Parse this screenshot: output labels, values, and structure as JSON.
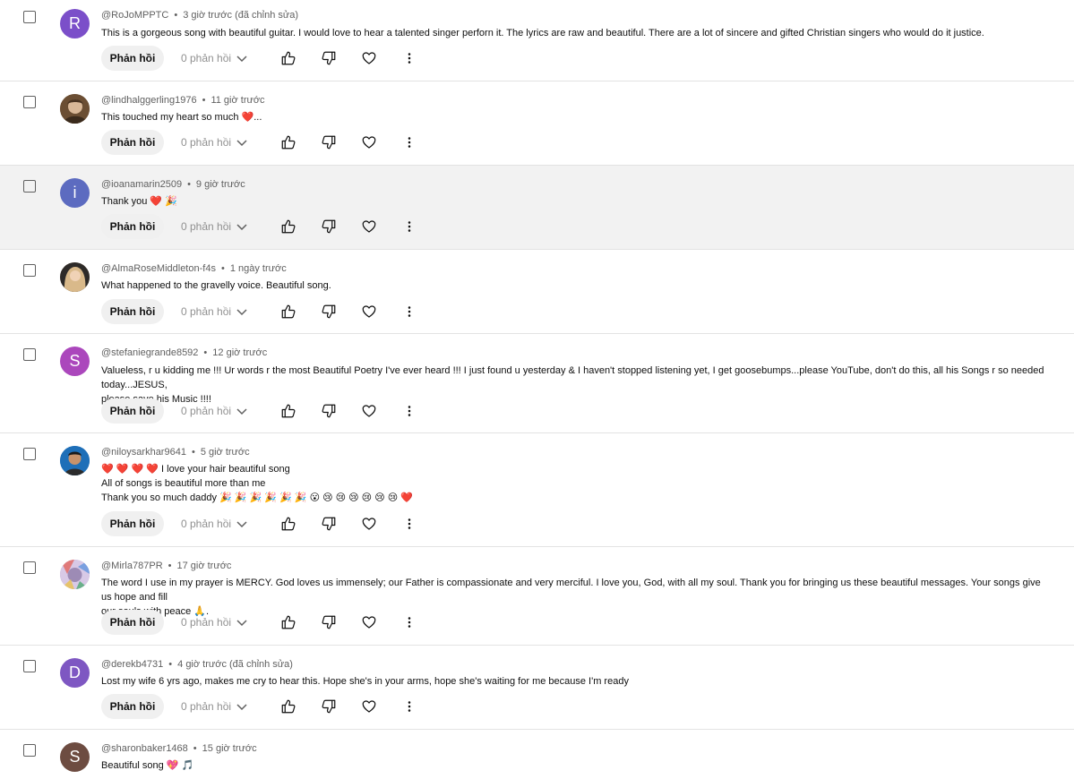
{
  "labels": {
    "reply_button": "Phản hồi",
    "reply_count": "0 phản hồi"
  },
  "comments": [
    {
      "handle": "@RoJoMPPTC",
      "time": "3 giờ trước (đã chỉnh sửa)",
      "text": [
        "This is a gorgeous song with beautiful guitar.   I would love to hear a talented singer perforn it.  The lyrics are raw and beautiful.  There are a lot of sincere and gifted Christian singers who would do it justice."
      ],
      "avatar_letter": "R",
      "avatar_color": "#7b4fc9"
    },
    {
      "handle": "@lindhalggerling1976",
      "time": "11 giờ trước",
      "text": [
        "This touched my heart so much ❤️..."
      ],
      "avatar_letter": "",
      "avatar_color": "#8a6a4a"
    },
    {
      "handle": "@ioanamarin2509",
      "time": "9 giờ trước",
      "text": [
        "Thank you ❤️ 🎉"
      ],
      "avatar_letter": "i",
      "avatar_color": "#5c6bc0"
    },
    {
      "handle": "@AlmaRoseMiddleton-f4s",
      "time": "1 ngày trước",
      "text": [
        "What happened to the gravelly voice. Beautiful song."
      ],
      "avatar_letter": "",
      "avatar_color": "#c9a77a"
    },
    {
      "handle": "@stefaniegrande8592",
      "time": "12 giờ trước",
      "text": [
        "Valueless, r u kidding me !!! Ur words r the most Beautiful Poetry I've ever heard !!! I just found u yesterday & I haven't stopped listening yet, I get goosebumps...please YouTube, don't do this, all his Songs r so needed today...JESUS,",
        "please save his Music !!!!"
      ],
      "avatar_letter": "S",
      "avatar_color": "#ab47bc"
    },
    {
      "handle": "@niloysarkhar9641",
      "time": "5 giờ trước",
      "text": [
        "❤️ ❤️ ❤️ ❤️ I love your hair beautiful song",
        "All of songs is beautiful more than me",
        "Thank you so much  daddy 🎉 🎉 🎉 🎉 🎉 🎉 😮 😢 😢 😢 😢 😢 😢 ❤️"
      ],
      "avatar_letter": "",
      "avatar_color": "#1e6fb8"
    },
    {
      "handle": "@Mirla787PR",
      "time": "17 giờ trước",
      "text": [
        "The word I use in my prayer is MERCY. God loves us immensely; our Father is compassionate and very merciful. I love you, God, with all my soul. Thank you for bringing us these beautiful messages. Your songs give us hope and fill",
        "our souls with peace 🙏."
      ],
      "avatar_letter": "",
      "avatar_color": "#b0a0c0"
    },
    {
      "handle": "@derekb4731",
      "time": "4 giờ trước (đã chỉnh sửa)",
      "text": [
        "Lost my wife 6 yrs ago, makes me cry to hear this. Hope she's in your arms, hope she's waiting for me because I'm ready"
      ],
      "avatar_letter": "D",
      "avatar_color": "#7e57c2"
    },
    {
      "handle": "@sharonbaker1468",
      "time": "15 giờ trước",
      "text": [
        "Beautiful song 💖 🎵"
      ],
      "avatar_letter": "S",
      "avatar_color": "#6d4c41"
    }
  ]
}
